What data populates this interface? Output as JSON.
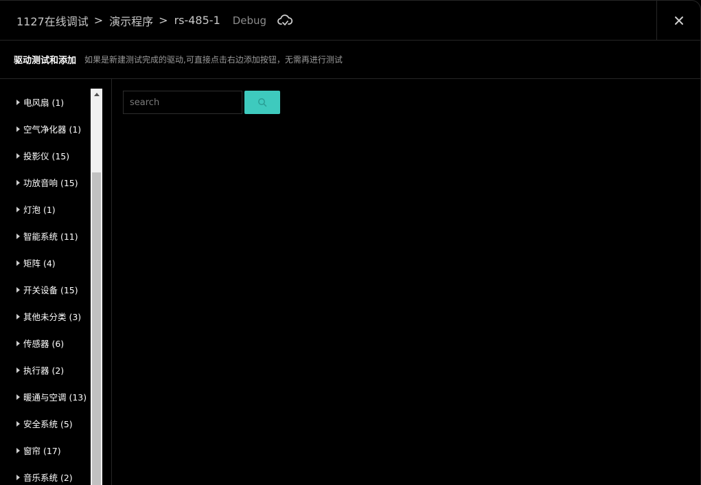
{
  "header": {
    "breadcrumb": [
      "1127在线调试",
      "演示程序",
      "rs-485-1"
    ],
    "separator": ">",
    "mode": "Debug",
    "cloud_icon": "cloud-check-icon",
    "close_icon": "close-icon"
  },
  "subheader": {
    "title": "驱动测试和添加",
    "description": "如果是新建测试完成的驱动,可直接点击右边添加按钮，无需再进行测试"
  },
  "sidebar": {
    "items": [
      {
        "label": "电风扇 (1)"
      },
      {
        "label": "空气净化器 (1)"
      },
      {
        "label": "投影仪 (15)"
      },
      {
        "label": "功放音响 (15)"
      },
      {
        "label": "灯泡 (1)"
      },
      {
        "label": "智能系统 (11)"
      },
      {
        "label": "矩阵 (4)"
      },
      {
        "label": "开关设备 (15)"
      },
      {
        "label": "其他未分类 (3)"
      },
      {
        "label": "传感器 (6)"
      },
      {
        "label": "执行器 (2)"
      },
      {
        "label": "暖通与空调 (13)"
      },
      {
        "label": "安全系统 (5)"
      },
      {
        "label": "窗帘 (17)"
      },
      {
        "label": "音乐系统 (2)"
      }
    ]
  },
  "search": {
    "placeholder": "search",
    "value": "",
    "button_icon": "search-icon"
  },
  "colors": {
    "accent": "#3ecabe",
    "background": "#000000",
    "border": "#262626"
  }
}
